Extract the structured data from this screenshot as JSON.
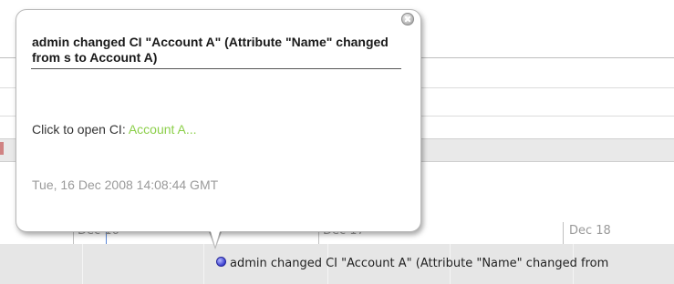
{
  "popup": {
    "title": "admin changed CI \"Account A\" (Attribute \"Name\" changed from s to Account A)",
    "open_prefix": "Click to open CI: ",
    "link_text": "Account A...",
    "timestamp": "Tue, 16 Dec 2008 14:08:44 GMT",
    "close_icon": "close-icon"
  },
  "timeline": {
    "dates": [
      {
        "label": "Dec 16"
      },
      {
        "label": "Dec 17"
      },
      {
        "label": "Dec 18"
      }
    ],
    "event": {
      "text": "admin changed CI \"Account A\" (Attribute \"Name\" changed from",
      "marker_icon": "event-dot-icon"
    }
  },
  "colors": {
    "link": "#8ccf4a",
    "event_marker": "#3a3fd0",
    "band": "#e6e6e6"
  }
}
